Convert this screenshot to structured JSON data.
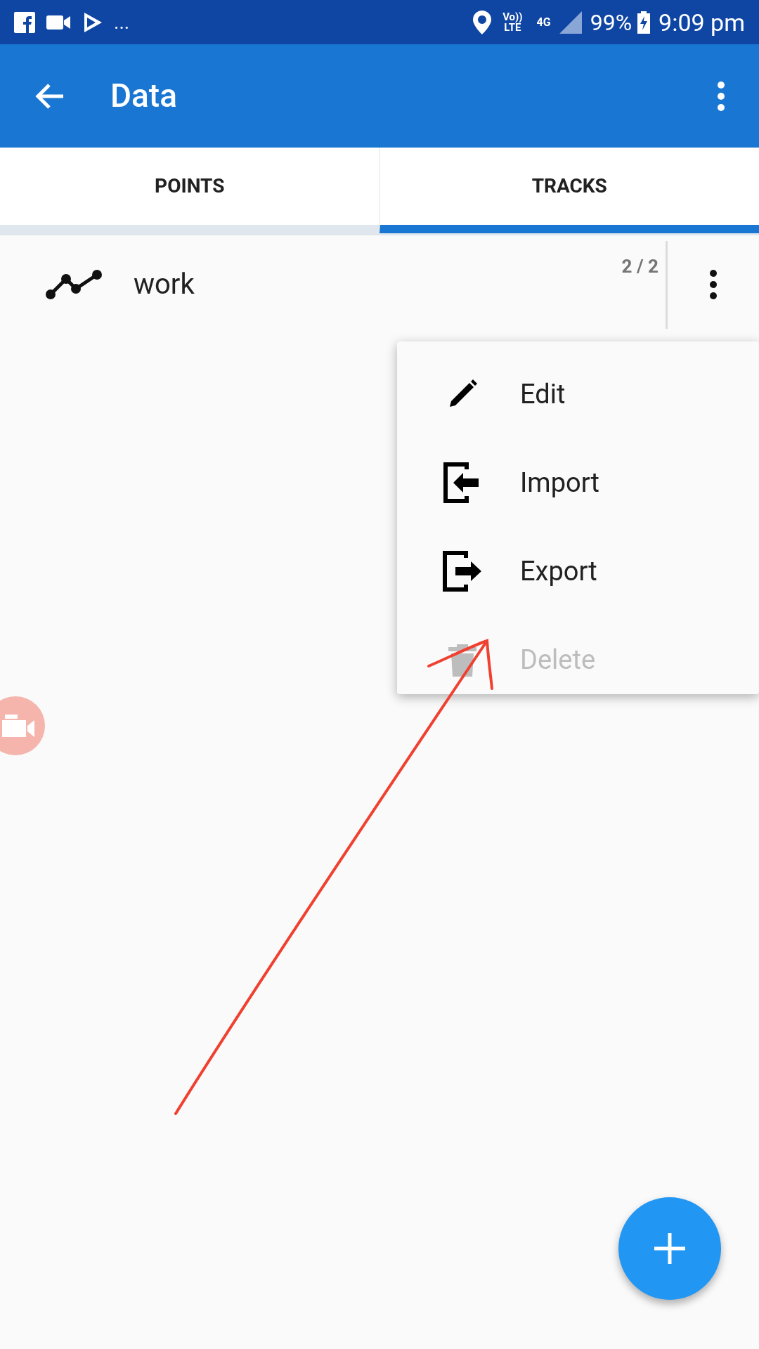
{
  "status_bar": {
    "ellipsis": "...",
    "volte": "Vo))",
    "lte": "LTE",
    "network": "4G",
    "battery": "99%",
    "time": "9:09 pm"
  },
  "app_bar": {
    "title": "Data"
  },
  "tabs": [
    {
      "label": "POINTS",
      "selected": false
    },
    {
      "label": "TRACKS",
      "selected": true
    }
  ],
  "tracks": [
    {
      "name": "work",
      "count": "2 / 2"
    }
  ],
  "menu": [
    {
      "kind": "edit",
      "label": "Edit",
      "disabled": false
    },
    {
      "kind": "import",
      "label": "Import",
      "disabled": false
    },
    {
      "kind": "export",
      "label": "Export",
      "disabled": false
    },
    {
      "kind": "delete",
      "label": "Delete",
      "disabled": true
    }
  ]
}
